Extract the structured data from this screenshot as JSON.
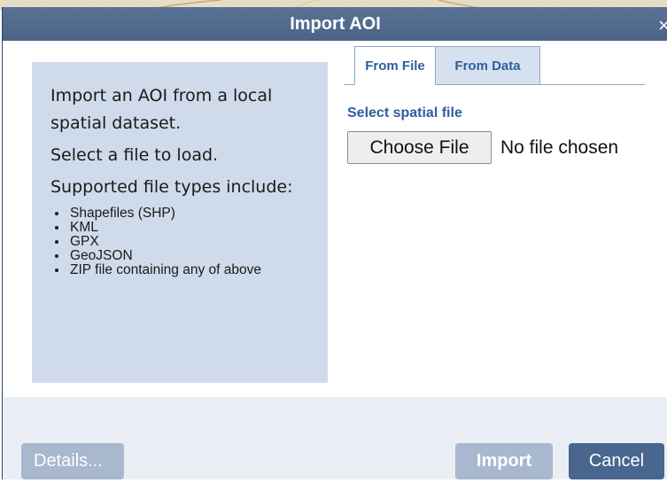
{
  "dialog": {
    "title": "Import AOI",
    "close_symbol": "×"
  },
  "info": {
    "paragraphs": [
      "Import an AOI from a local spatial dataset.",
      "Select a file to load.",
      "Supported file types include:"
    ],
    "file_types": [
      "Shapefiles (SHP)",
      "KML",
      "GPX",
      "GeoJSON",
      "ZIP file containing any of above"
    ]
  },
  "tabs": [
    {
      "label": "From File",
      "active": true
    },
    {
      "label": "From Data",
      "active": false
    }
  ],
  "file_input": {
    "label": "Select spatial file",
    "button_label": "Choose File",
    "status": "No file chosen"
  },
  "buttons": {
    "details": "Details...",
    "import": "Import",
    "cancel": "Cancel"
  },
  "colors": {
    "titlebar": "#4f698d",
    "info_panel": "#cfdbea",
    "accent_text": "#2e5e9e",
    "disabled_button": "#a7b8cf",
    "cancel_button": "#48668e"
  },
  "icons": {
    "close": "close-icon"
  }
}
